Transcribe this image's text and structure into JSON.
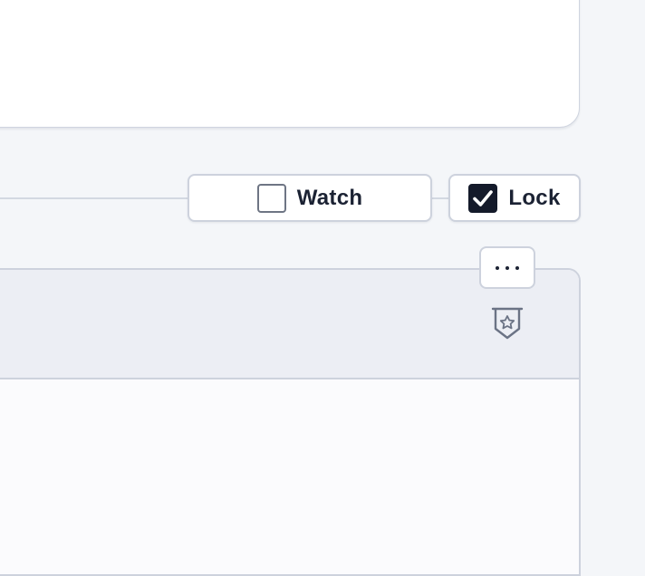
{
  "actions": {
    "watch": {
      "label": "Watch",
      "checked": false
    },
    "lock": {
      "label": "Lock",
      "checked": true
    }
  },
  "panel": {
    "more_icon": "more-horizontal-icon",
    "badge_icon": "shield-star-icon"
  },
  "colors": {
    "page_bg": "#f4f6f9",
    "border": "#cdd2dd",
    "checked_fill": "#141a2a",
    "header_bg": "#eceef4",
    "icon_stroke": "#6b7385"
  }
}
